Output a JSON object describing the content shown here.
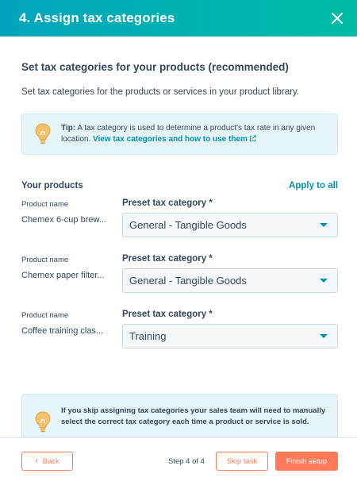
{
  "header": {
    "title": "4. Assign tax categories"
  },
  "intro": {
    "title": "Set tax categories for your products (recommended)",
    "description": "Set tax categories for the products or services in your product library."
  },
  "tip": {
    "label": "Tip:",
    "text": " A tax category is used to determine a product's tax rate in any given location. ",
    "link": "View tax categories and how to use them"
  },
  "products": {
    "title": "Your products",
    "apply_all": "Apply to all",
    "rows": [
      {
        "field_label": "Product name",
        "name": "Chemex 6-cup brew...",
        "category_label": "Preset tax category *",
        "category": "General - Tangible Goods"
      },
      {
        "field_label": "Product name",
        "name": "Chemex paper filter...",
        "category_label": "Preset tax category *",
        "category": "General - Tangible Goods"
      },
      {
        "field_label": "Product name",
        "name": "Coffee training clas...",
        "category_label": "Preset tax category *",
        "category": "Training"
      }
    ]
  },
  "warning": {
    "text": "If you skip assigning tax categories your sales team will need to manually select the correct tax category each time a product or service is sold."
  },
  "footer": {
    "back": "Back",
    "step": "Step 4 of 4",
    "skip": "Skip task",
    "finish": "Finish setup"
  },
  "colors": {
    "header_start": "#00a4bd",
    "header_end": "#00bda5",
    "link": "#0091ae",
    "accent": "#ff7a59",
    "tip_bg": "#e5f5f8",
    "text": "#33475b"
  },
  "icons": [
    "close-icon",
    "lightbulb-icon",
    "external-link-icon",
    "chevron-down-icon",
    "chevron-left-icon"
  ]
}
